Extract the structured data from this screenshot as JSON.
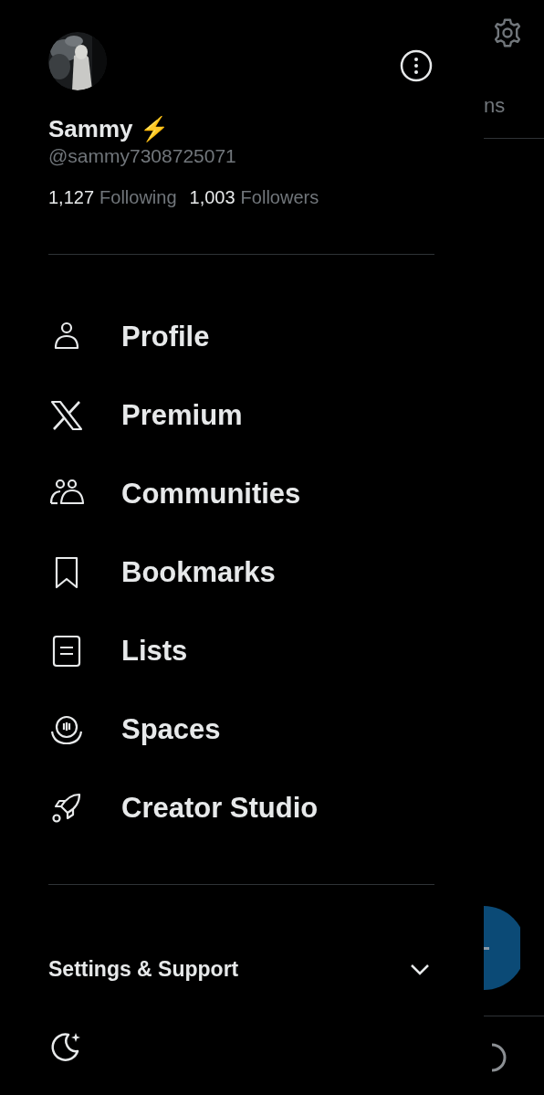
{
  "profile": {
    "name": "Sammy ⚡",
    "handle": "@sammy7308725071",
    "following_count": "1,127",
    "following_label": "Following",
    "followers_count": "1,003",
    "followers_label": "Followers"
  },
  "menu": [
    {
      "kind": "profile",
      "label": "Profile"
    },
    {
      "kind": "premium",
      "label": "Premium"
    },
    {
      "kind": "communities",
      "label": "Communities"
    },
    {
      "kind": "bookmarks",
      "label": "Bookmarks"
    },
    {
      "kind": "lists",
      "label": "Lists"
    },
    {
      "kind": "spaces",
      "label": "Spaces"
    },
    {
      "kind": "creator",
      "label": "Creator Studio"
    }
  ],
  "settings_section": {
    "label": "Settings & Support",
    "expanded": false
  },
  "background": {
    "tab_label": "ns"
  }
}
